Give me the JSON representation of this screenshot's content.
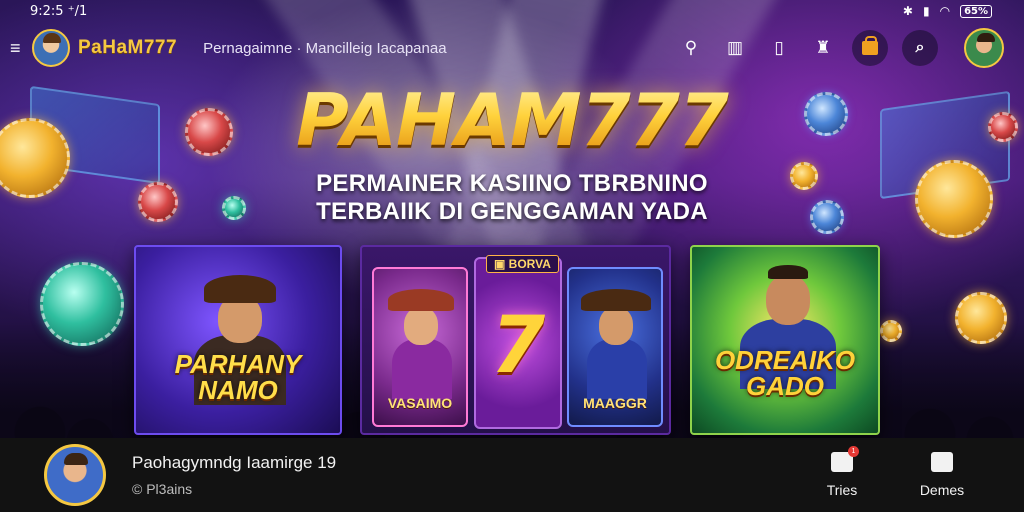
{
  "status_bar": {
    "time": "9:2:5 ⁺/1",
    "battery": "65%"
  },
  "top_nav": {
    "brand_name": "PaHaM777",
    "links_text": "Pernagaimne · Mancilleig Iacapanaa"
  },
  "hero": {
    "title": "PAHAM777",
    "subtitle_line1": "PERMAINER KASIINO TBRBNINO",
    "subtitle_line2": "TERBAIIK DI GENGGAMAN YADA"
  },
  "cards": {
    "left_label_line1": "PARHANY",
    "left_label_line2": "NAMO",
    "bonus_tag": "BORVA",
    "seven": "7",
    "mid_left_label": "VASAIMO",
    "mid_right_label": "MAAGGR",
    "right_label_line1": "ODREAIKO",
    "right_label_line2": "GADO"
  },
  "bottom_bar": {
    "title": "Paohagymndg Iaamirge 19",
    "subtitle": "© Pl3ains",
    "actions": [
      {
        "label": "Tries",
        "icon": "gift-icon",
        "badge": "1"
      },
      {
        "label": "Demes",
        "icon": "bookmark-icon"
      }
    ]
  },
  "colors": {
    "brand_gold": "#f5c842",
    "background": "#2a1658",
    "bottom_bar": "#121212"
  }
}
